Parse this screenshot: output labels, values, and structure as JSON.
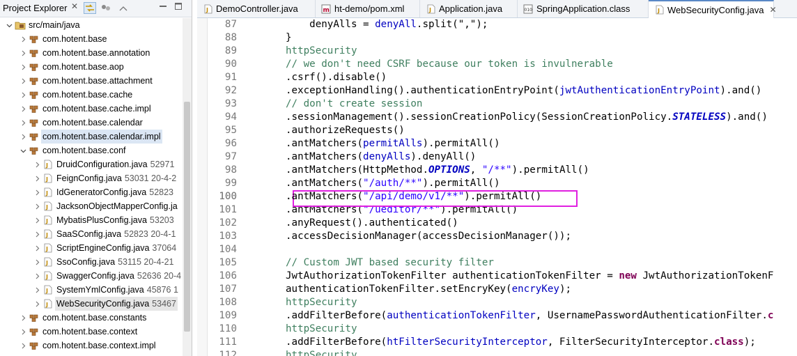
{
  "explorer": {
    "title": "Project Explorer",
    "close_glyph": "✕",
    "items": [
      {
        "label": "src/main/java",
        "meta": "",
        "icon": "source-folder-icon",
        "depth": 0,
        "twisty": "open"
      },
      {
        "label": "com.hotent.base",
        "meta": "",
        "icon": "package-icon",
        "depth": 1,
        "twisty": "closed"
      },
      {
        "label": "com.hotent.base.annotation",
        "meta": "",
        "icon": "package-icon",
        "depth": 1,
        "twisty": "closed"
      },
      {
        "label": "com.hotent.base.aop",
        "meta": "",
        "icon": "package-icon",
        "depth": 1,
        "twisty": "closed"
      },
      {
        "label": "com.hotent.base.attachment",
        "meta": "",
        "icon": "package-icon",
        "depth": 1,
        "twisty": "closed"
      },
      {
        "label": "com.hotent.base.cache",
        "meta": "",
        "icon": "package-icon",
        "depth": 1,
        "twisty": "closed"
      },
      {
        "label": "com.hotent.base.cache.impl",
        "meta": "",
        "icon": "package-icon",
        "depth": 1,
        "twisty": "closed"
      },
      {
        "label": "com.hotent.base.calendar",
        "meta": "",
        "icon": "package-icon",
        "depth": 1,
        "twisty": "closed"
      },
      {
        "label": "com.hotent.base.calendar.impl",
        "meta": "",
        "icon": "package-icon",
        "depth": 1,
        "twisty": "closed",
        "state": "selected"
      },
      {
        "label": "com.hotent.base.conf",
        "meta": "",
        "icon": "package-icon",
        "depth": 1,
        "twisty": "open"
      },
      {
        "label": "DruidConfiguration.java",
        "meta": "52971",
        "icon": "java-file-icon",
        "depth": 2,
        "twisty": "closed"
      },
      {
        "label": "FeignConfig.java",
        "meta": "53031  20-4-2",
        "icon": "java-file-icon",
        "depth": 2,
        "twisty": "closed"
      },
      {
        "label": "IdGeneratorConfig.java",
        "meta": "52823",
        "icon": "java-file-icon",
        "depth": 2,
        "twisty": "closed"
      },
      {
        "label": "JacksonObjectMapperConfig.ja",
        "meta": "",
        "icon": "java-file-icon",
        "depth": 2,
        "twisty": "closed"
      },
      {
        "label": "MybatisPlusConfig.java",
        "meta": "53203",
        "icon": "java-file-icon",
        "depth": 2,
        "twisty": "closed"
      },
      {
        "label": "SaaSConfig.java",
        "meta": "52823  20-4-1",
        "icon": "java-file-icon",
        "depth": 2,
        "twisty": "closed"
      },
      {
        "label": "ScriptEngineConfig.java",
        "meta": "37064",
        "icon": "java-file-icon",
        "depth": 2,
        "twisty": "closed"
      },
      {
        "label": "SsoConfig.java",
        "meta": "53115  20-4-21",
        "icon": "java-file-icon",
        "depth": 2,
        "twisty": "closed"
      },
      {
        "label": "SwaggerConfig.java",
        "meta": "52636  20-4",
        "icon": "java-file-icon",
        "depth": 2,
        "twisty": "closed"
      },
      {
        "label": "SystemYmlConfig.java",
        "meta": "45876  1",
        "icon": "java-file-icon",
        "depth": 2,
        "twisty": "closed"
      },
      {
        "label": "WebSecurityConfig.java",
        "meta": "53467",
        "icon": "java-file-icon",
        "depth": 2,
        "twisty": "closed",
        "state": "open-file"
      },
      {
        "label": "com.hotent.base.constants",
        "meta": "",
        "icon": "package-icon",
        "depth": 1,
        "twisty": "closed"
      },
      {
        "label": "com.hotent.base.context",
        "meta": "",
        "icon": "package-icon",
        "depth": 1,
        "twisty": "closed"
      },
      {
        "label": "com.hotent.base.context.impl",
        "meta": "",
        "icon": "package-icon",
        "depth": 1,
        "twisty": "closed"
      }
    ]
  },
  "tabs": [
    {
      "label": "DemoController.java",
      "icon": "java-file-icon",
      "active": false
    },
    {
      "label": "ht-demo/pom.xml",
      "icon": "maven-pom-icon",
      "active": false
    },
    {
      "label": "Application.java",
      "icon": "java-file-icon",
      "active": false
    },
    {
      "label": "SpringApplication.class",
      "icon": "class-file-icon",
      "active": false
    },
    {
      "label": "WebSecurityConfig.java",
      "icon": "java-file-icon",
      "active": true,
      "close": "✕"
    }
  ],
  "editor": {
    "highlighted_line": 100,
    "lines": [
      {
        "n": "87",
        "tokens": [
          [
            "    denyAlls = ",
            "p"
          ],
          [
            "denyAll",
            "f"
          ],
          [
            ".split(\",\");",
            "p"
          ]
        ]
      },
      {
        "n": "88",
        "tokens": [
          [
            "}",
            "p"
          ]
        ]
      },
      {
        "n": "89",
        "tokens": [
          [
            "httpSecurity",
            "c"
          ]
        ]
      },
      {
        "n": "90",
        "tokens": [
          [
            "// we don't need CSRF because our token is invulnerable",
            "c"
          ]
        ]
      },
      {
        "n": "91",
        "tokens": [
          [
            ".csrf().disable()",
            "p"
          ]
        ]
      },
      {
        "n": "92",
        "tokens": [
          [
            ".exceptionHandling().authenticationEntryPoint(",
            "p"
          ],
          [
            "jwtAuthenticationEntryPoint",
            "f"
          ],
          [
            ").and()",
            "p"
          ]
        ]
      },
      {
        "n": "93",
        "tokens": [
          [
            "// don't create session",
            "c"
          ]
        ]
      },
      {
        "n": "94",
        "tokens": [
          [
            ".sessionManagement().sessionCreationPolicy(SessionCreationPolicy.",
            "p"
          ],
          [
            "STATELESS",
            "fb"
          ],
          [
            ").and()",
            "p"
          ]
        ]
      },
      {
        "n": "95",
        "tokens": [
          [
            ".authorizeRequests()",
            "p"
          ]
        ]
      },
      {
        "n": "96",
        "tokens": [
          [
            ".antMatchers(",
            "p"
          ],
          [
            "permitAlls",
            "f"
          ],
          [
            ").permitAll()",
            "p"
          ]
        ]
      },
      {
        "n": "97",
        "tokens": [
          [
            ".antMatchers(",
            "p"
          ],
          [
            "denyAlls",
            "f"
          ],
          [
            ").denyAll()",
            "p"
          ]
        ]
      },
      {
        "n": "98",
        "tokens": [
          [
            ".antMatchers(HttpMethod.",
            "p"
          ],
          [
            "OPTIONS",
            "fb"
          ],
          [
            ", ",
            "p"
          ],
          [
            "\"/**\"",
            "s"
          ],
          [
            ").permitAll()",
            "p"
          ]
        ]
      },
      {
        "n": "99",
        "tokens": [
          [
            ".antMatchers(",
            "p"
          ],
          [
            "\"/auth/**\"",
            "s"
          ],
          [
            ").permitAll()",
            "p"
          ]
        ]
      },
      {
        "n": "100",
        "tokens": [
          [
            ".antMatchers(",
            "p"
          ],
          [
            "\"/api/demo/v1/**\"",
            "s"
          ],
          [
            ").permitAll()",
            "p"
          ]
        ]
      },
      {
        "n": "101",
        "tokens": [
          [
            ".antMatchers(",
            "p"
          ],
          [
            "\"/ueditor/**\"",
            "s"
          ],
          [
            ").permitAll()",
            "p"
          ]
        ]
      },
      {
        "n": "102",
        "tokens": [
          [
            ".anyRequest().authenticated()",
            "p"
          ]
        ]
      },
      {
        "n": "103",
        "tokens": [
          [
            ".accessDecisionManager(accessDecisionManager());",
            "p"
          ]
        ]
      },
      {
        "n": "104",
        "tokens": []
      },
      {
        "n": "105",
        "tokens": [
          [
            "// Custom JWT based security filter",
            "c"
          ]
        ]
      },
      {
        "n": "106",
        "tokens": [
          [
            "JwtAuthorizationTokenFilter authenticationTokenFilter = ",
            "p"
          ],
          [
            "new",
            "k"
          ],
          [
            " JwtAuthorizationTokenF",
            "p"
          ]
        ]
      },
      {
        "n": "107",
        "tokens": [
          [
            "authenticationTokenFilter.setEncryKey(",
            "p"
          ],
          [
            "encryKey",
            "f"
          ],
          [
            ");",
            "p"
          ]
        ]
      },
      {
        "n": "108",
        "tokens": [
          [
            "httpSecurity",
            "c"
          ]
        ]
      },
      {
        "n": "109",
        "tokens": [
          [
            ".addFilterBefore(",
            "p"
          ],
          [
            "authenticationTokenFilter",
            "f"
          ],
          [
            ", UsernamePasswordAuthenticationFilter.",
            "p"
          ],
          [
            "c",
            "k"
          ]
        ]
      },
      {
        "n": "110",
        "tokens": [
          [
            "httpSecurity",
            "c"
          ]
        ]
      },
      {
        "n": "111",
        "tokens": [
          [
            ".addFilterBefore(",
            "p"
          ],
          [
            "htFilterSecurityInterceptor",
            "f"
          ],
          [
            ", FilterSecurityInterceptor.",
            "p"
          ],
          [
            "class",
            "k"
          ],
          [
            ");",
            "p"
          ]
        ]
      },
      {
        "n": "112",
        "tokens": [
          [
            "httpSecurity",
            "c"
          ]
        ]
      }
    ]
  }
}
